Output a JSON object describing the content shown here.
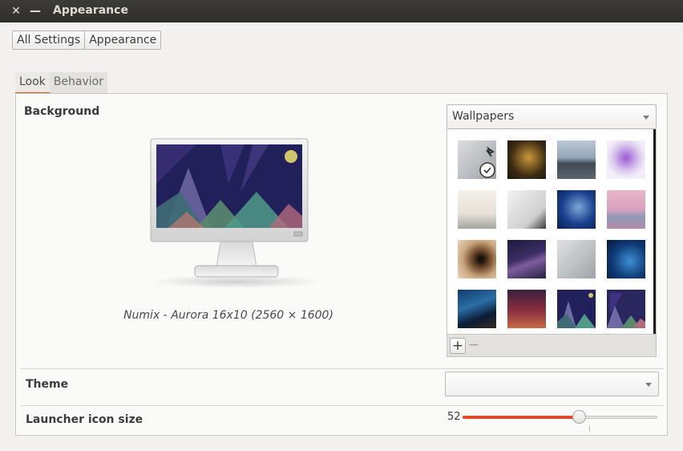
{
  "window": {
    "title": "Appearance",
    "close_glyph": "✕",
    "minimize_glyph": "—"
  },
  "breadcrumb": [
    "All Settings",
    "Appearance"
  ],
  "tabs": [
    {
      "label": "Look",
      "active": true
    },
    {
      "label": "Behavior",
      "active": false
    }
  ],
  "background": {
    "label": "Background",
    "caption": "Numix - Aurora 16x10 (2560 × 1600)",
    "source_dropdown": "Wallpapers",
    "add_label": "+",
    "remove_label": "−",
    "thumbnails": [
      "grey-sky-plane-selected",
      "mushrooms",
      "rocky-shore",
      "purple-flowers",
      "foggy-field",
      "white-mist",
      "jellyfish",
      "pink-lake",
      "tunnel",
      "purple-road",
      "grey-sky-plane",
      "blue-bokeh",
      "starry-night",
      "red-haze",
      "numix-aurora",
      "numix-aurora-alt"
    ]
  },
  "theme": {
    "label": "Theme",
    "value": ""
  },
  "launcher": {
    "label": "Launcher icon size",
    "value": "52",
    "fraction": 0.6
  },
  "colors": {
    "accent": "#dc4c2c",
    "titlebar": "#3c3b37"
  }
}
